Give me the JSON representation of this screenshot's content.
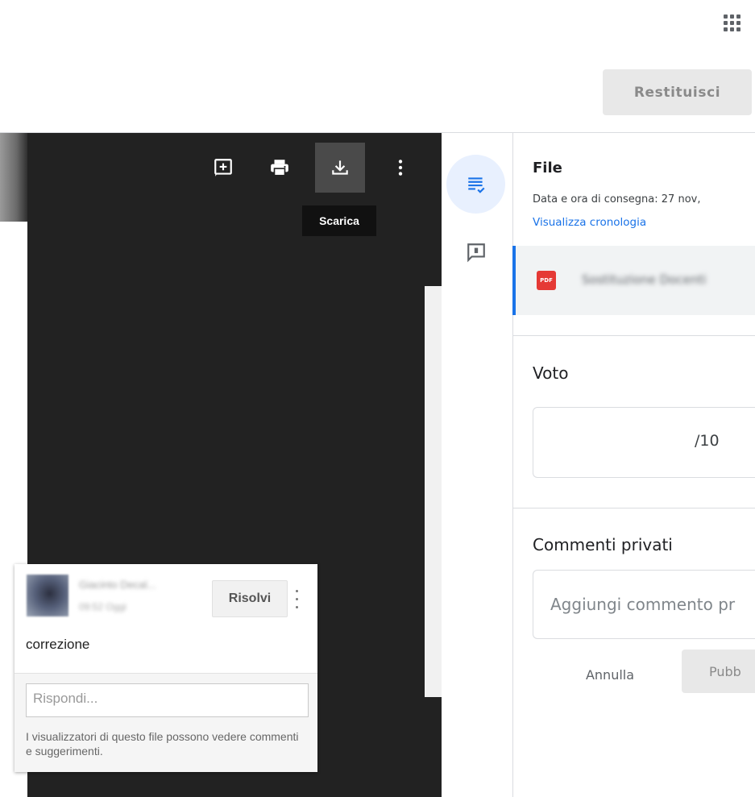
{
  "header": {
    "apps_icon": "apps-grid-icon",
    "return_button": "Restituisci"
  },
  "viewer": {
    "toolbar": {
      "add_comment_icon": "add-comment-icon",
      "print_icon": "print-icon",
      "download_icon": "download-icon",
      "more_icon": "more-vert-icon"
    },
    "tooltip": "Scarica",
    "comment": {
      "author": "Giacinto Decal...",
      "time": "09:52 Oggi",
      "resolve_label": "Risolvi",
      "text": "correzione",
      "reply_placeholder": "Rispondi...",
      "info": "I visualizzatori di questo file possono vedere commenti e suggerimenti."
    }
  },
  "rail": {
    "details_icon": "assignment-details-icon",
    "comments_icon": "comment-icon"
  },
  "panel": {
    "file_title": "File",
    "delivery_date": "Data e ora di consegna: 27 nov,",
    "history_link": "Visualizza cronologia",
    "file_name": "Sostituzione Docenti",
    "file_type_badge": "PDF",
    "grade_title": "Voto",
    "grade_suffix": "/10",
    "comments_title": "Commenti privati",
    "comment_placeholder": "Aggiungi commento pr",
    "cancel_label": "Annulla",
    "post_label": "Pubb"
  },
  "colors": {
    "accent": "#1a73e8",
    "viewer_bg": "#222222",
    "pdf_red": "#e53935"
  }
}
